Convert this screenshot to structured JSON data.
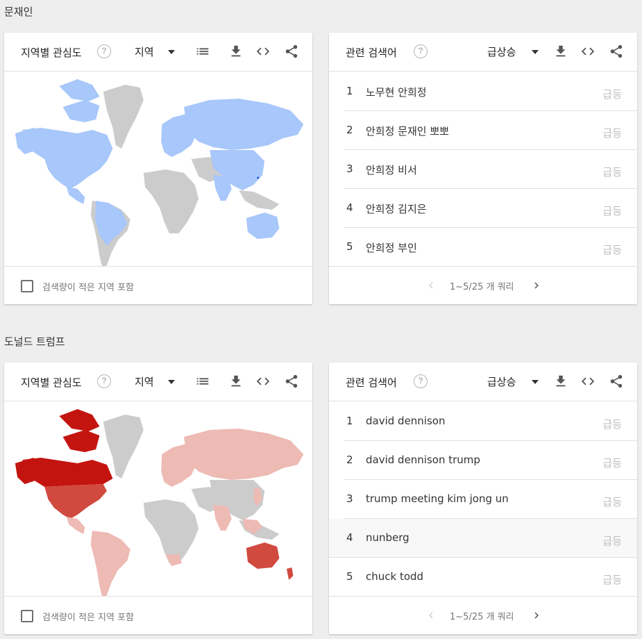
{
  "sections": [
    {
      "title": "문재인",
      "map_card": {
        "title": "지역별 관심도",
        "select_label": "지역",
        "include_low_volume": "검색량이 적은 지역 포함",
        "accent_colors": {
          "light": "#a8c7fa",
          "base": "#cccccc"
        }
      },
      "queries_card": {
        "title": "관련 검색어",
        "select_label": "급상승",
        "rows": [
          {
            "rank": "1",
            "term": "노무현 안희정",
            "badge": "급등"
          },
          {
            "rank": "2",
            "term": "안희정 문재인 뽀뽀",
            "badge": "급등"
          },
          {
            "rank": "3",
            "term": "안희정 비서",
            "badge": "급등"
          },
          {
            "rank": "4",
            "term": "안희정 김지은",
            "badge": "급등"
          },
          {
            "rank": "5",
            "term": "안희정 부인",
            "badge": "급등"
          }
        ],
        "pager": "1~5/25 개 쿼리"
      }
    },
    {
      "title": "도널드 트럼프",
      "map_card": {
        "title": "지역별 관심도",
        "select_label": "지역",
        "include_low_volume": "검색량이 적은 지역 포함",
        "accent_colors": {
          "dark": "#c4140f",
          "mid": "#d14a3f",
          "pale": "#eebab4",
          "base": "#cccccc"
        }
      },
      "queries_card": {
        "title": "관련 검색어",
        "select_label": "급상승",
        "rows": [
          {
            "rank": "1",
            "term": "david dennison",
            "badge": "급등"
          },
          {
            "rank": "2",
            "term": "david dennison trump",
            "badge": "급등"
          },
          {
            "rank": "3",
            "term": "trump meeting kim jong un",
            "badge": "급등"
          },
          {
            "rank": "4",
            "term": "nunberg",
            "badge": "급등"
          },
          {
            "rank": "5",
            "term": "chuck todd",
            "badge": "급등"
          }
        ],
        "pager": "1~5/25 개 쿼리"
      }
    }
  ],
  "icons": {
    "help": "help-circle-icon",
    "caret": "dropdown-caret-icon",
    "list": "list-view-icon",
    "download": "download-icon",
    "embed": "embed-code-icon",
    "share": "share-icon",
    "prev": "chevron-left-icon",
    "next": "chevron-right-icon"
  }
}
